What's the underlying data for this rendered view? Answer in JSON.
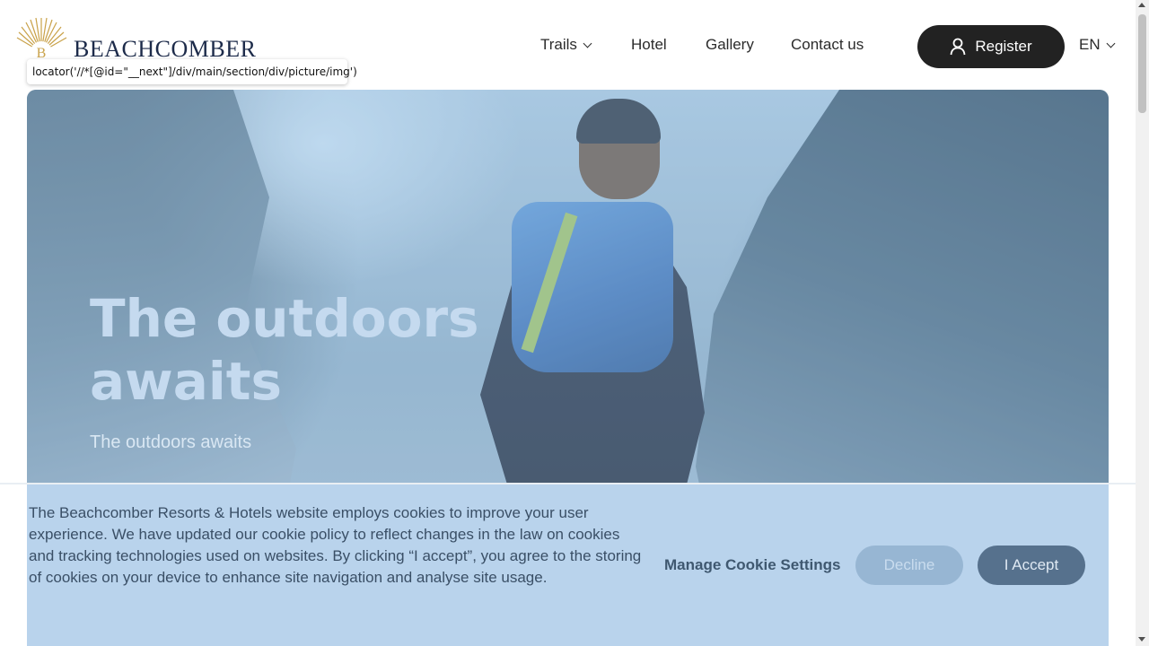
{
  "brand": {
    "name": "Beachcomber",
    "logo_letter": "B"
  },
  "nav": {
    "trails": "Trails",
    "hotel": "Hotel",
    "gallery": "Gallery",
    "contact": "Contact us",
    "register": "Register",
    "language": "EN"
  },
  "tooltip": {
    "text": "locator('//*[@id=\"__next\"]/div/main/section/div/picture/img')"
  },
  "hero": {
    "title": "The outdoors awaits",
    "subtitle": "The outdoors awaits"
  },
  "cookie_banner": {
    "message": "The Beachcomber Resorts & Hotels website employs cookies to improve your user experience. We have updated our cookie policy to reflect changes in the law on cookies and tracking technologies used on websites. By clicking “I accept”, you agree to the storing of cookies on your device to enhance site navigation and analyse site usage.",
    "manage_label": "Manage Cookie Settings",
    "decline_label": "Decline",
    "accept_label": "I Accept"
  },
  "colors": {
    "register_bg": "#222222",
    "cookie_bg": "#b9d3ec",
    "accept_bg": "#56718d",
    "decline_bg": "#97b6d3",
    "logo_gold": "#c9a24a",
    "logo_navy": "#1d2b4a"
  },
  "icons": {
    "user": "user-icon",
    "chevron": "chevron-down-icon",
    "logo_sun": "sun-rays-logo-icon"
  }
}
